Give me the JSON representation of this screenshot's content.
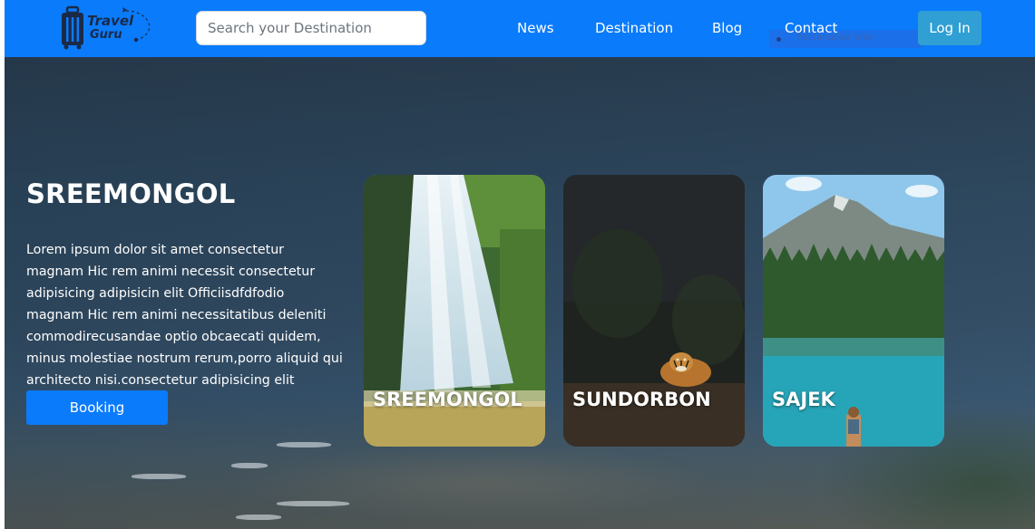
{
  "header": {
    "logo_line1": "Travel",
    "logo_line2": "Guru",
    "search_placeholder": "Search your Destination",
    "nav": [
      "News",
      "Destination",
      "Blog",
      "Contact"
    ],
    "login_label": "Log In",
    "overlay_tooltip": "Rectangular Snip"
  },
  "hero": {
    "title": "SREEMONGOL",
    "description": "Lorem ipsum dolor sit amet consectetur magnam Hic rem animi necessit consectetur adipisicing adipisicin elit Officiisdfdfodio magnam Hic rem animi necessitatibus deleniti commodirecusandae optio obcaecati quidem, minus molestiae nostrum rerum,porro aliquid qui architecto nisi.consectetur adipisicing elit",
    "booking_label": "Booking"
  },
  "cards": [
    {
      "name": "SREEMONGOL",
      "image": "waterfall-image"
    },
    {
      "name": "SUNDORBON",
      "image": "tiger-forest-image"
    },
    {
      "name": "SAJEK",
      "image": "mountain-lake-image"
    }
  ],
  "colors": {
    "primary": "#0a7bfb",
    "login_button": "#2f9fd4",
    "text_light": "#ffffff"
  }
}
